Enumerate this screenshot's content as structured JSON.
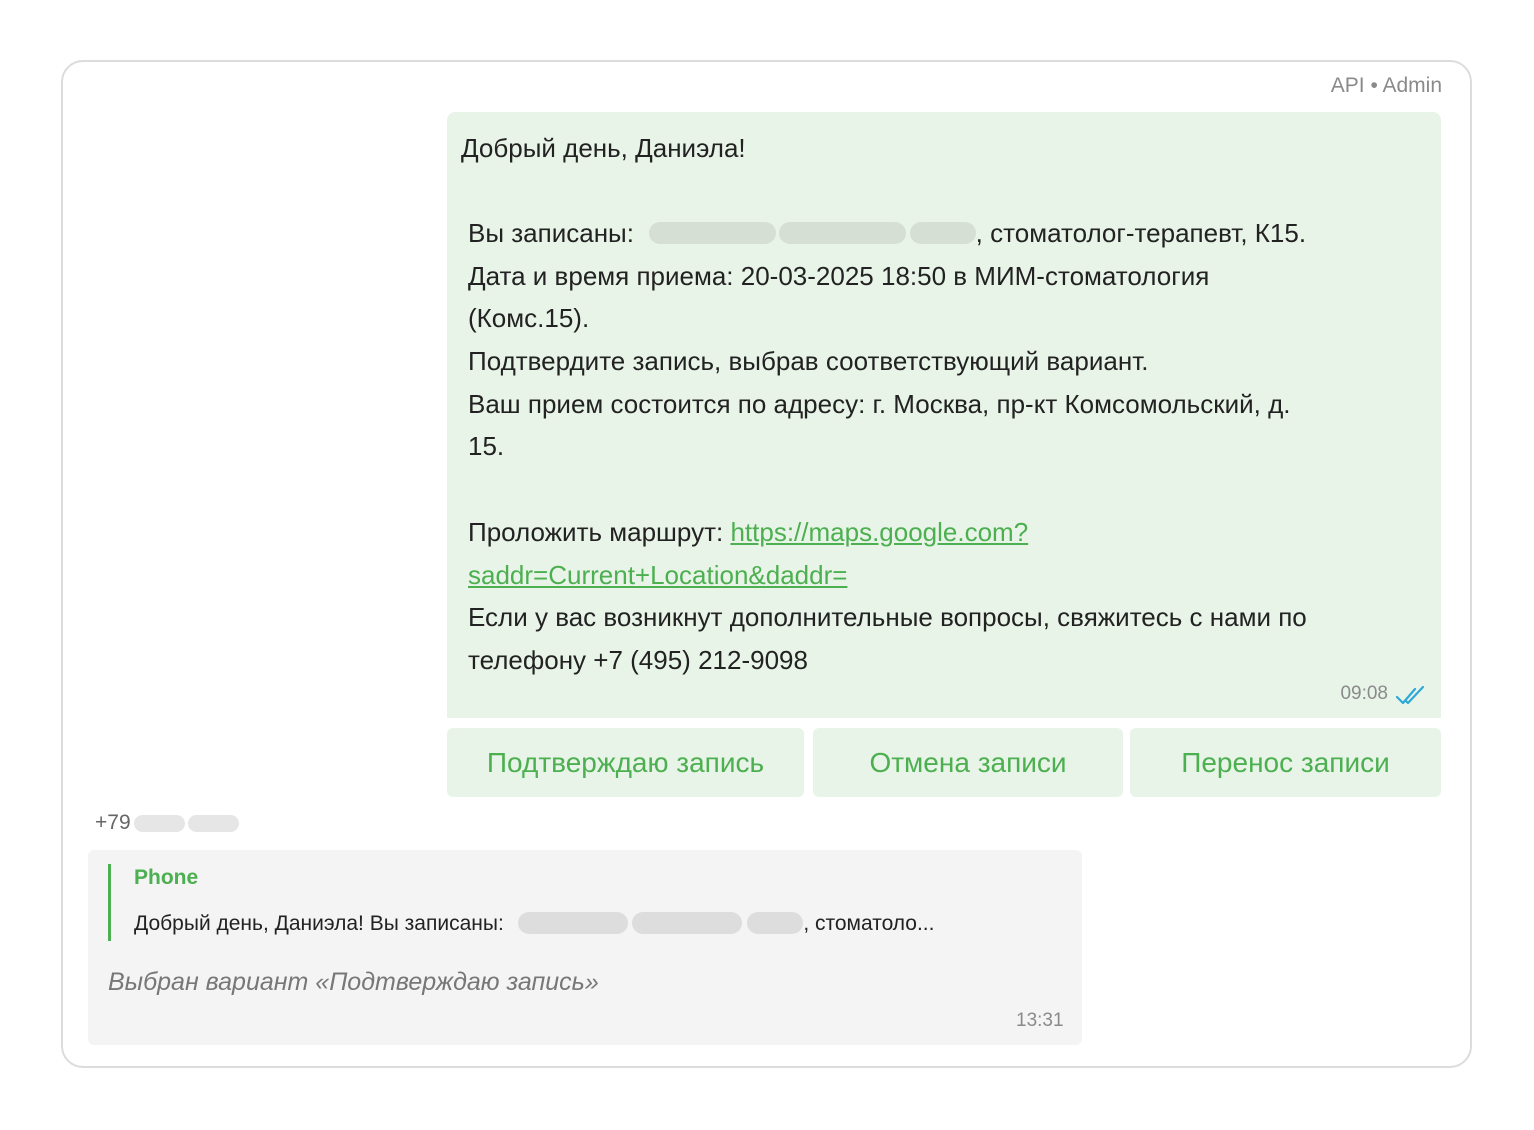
{
  "header": {
    "sender": "API • Admin"
  },
  "outgoing": {
    "greeting": "Добрый день, Даниэла!",
    "line1_prefix": "Вы записаны:",
    "line1_suffix": ", стоматолог-терапевт, К15.",
    "line2": "Дата и время приема: 20-03-2025 18:50 в МИМ-стоматология",
    "line3": "(Комс.15).",
    "line4": "Подтвердите запись, выбрав соответствующий вариант.",
    "line5": "Ваш прием состоится по адресу: г. Москва, пр-кт Комсомольский, д.",
    "line6": "15.",
    "route_label": "Проложить маршрут:",
    "route_link_1": "https://maps.google.com?",
    "route_link_2": "saddr=Current+Location&daddr=",
    "line9": "Если у вас возникнут дополнительные вопросы, свяжитесь с нами по",
    "line10": "телефону +7 (495) 212-9098",
    "time": "09:08",
    "status_icon": "double-check-icon"
  },
  "quick_replies": [
    {
      "label": "Подтверждаю запись"
    },
    {
      "label": "Отмена записи"
    },
    {
      "label": "Перенос записи"
    }
  ],
  "incoming": {
    "phone_prefix": "+79",
    "quote_title": "Phone",
    "quote_prefix": "Добрый день, Даниэла! Вы записаны:",
    "quote_suffix": ", стоматоло...",
    "selected_text": "Выбран вариант «Подтверждаю запись»",
    "time": "13:31"
  },
  "colors": {
    "accent": "#4caf50",
    "outgoing_bubble": "#e9f4e8",
    "incoming_bubble": "#f4f4f4",
    "read_check": "#2fa8d8"
  }
}
